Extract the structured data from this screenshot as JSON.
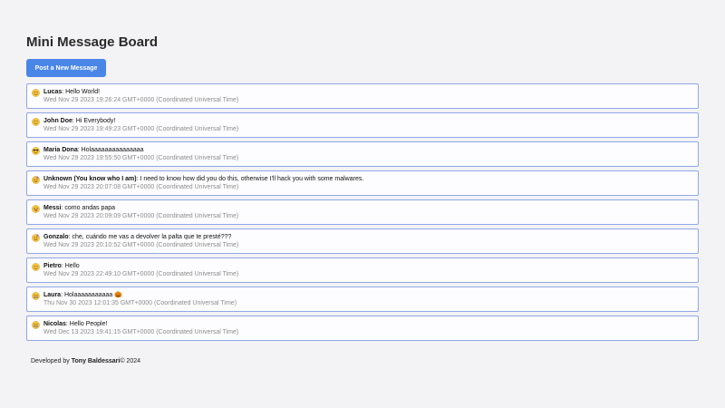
{
  "header": {
    "title": "Mini Message Board",
    "post_button_label": "Post a New Message"
  },
  "messages": [
    {
      "emoji": "winking-face-icon",
      "author": "Lucas",
      "text": "Hello World!",
      "date": "Wed Nov 29 2023 19:26:24 GMT+0000 (Coordinated Universal Time)"
    },
    {
      "emoji": "winking-face-icon",
      "author": "John Doe",
      "text": "Hi Everybody!",
      "date": "Wed Nov 29 2023 19:49:23 GMT+0000 (Coordinated Universal Time)"
    },
    {
      "emoji": "sunglasses-face-icon",
      "author": "Maria Dona",
      "text": "Holaaaaaaaaaaaaaaa",
      "date": "Wed Nov 29 2023 19:55:50 GMT+0000 (Coordinated Universal Time)"
    },
    {
      "emoji": "party-face-icon",
      "author": "Unknown (You know who I am)",
      "text": "I need to know how did you do this, otherwise I'll hack you with some malwares.",
      "date": "Wed Nov 29 2023 20:07:08 GMT+0000 (Coordinated Universal Time)"
    },
    {
      "emoji": "tongue-face-icon",
      "author": "Messi",
      "text": "como andas papa",
      "date": "Wed Nov 29 2023 20:09:09 GMT+0000 (Coordinated Universal Time)"
    },
    {
      "emoji": "party-face-icon",
      "author": "Gonzalo",
      "text": "che, cuándo me vas a devolver la palta que te presté???",
      "date": "Wed Nov 29 2023 20:10:52 GMT+0000 (Coordinated Universal Time)"
    },
    {
      "emoji": "winking-face-icon",
      "author": "Pietro",
      "text": "Hello",
      "date": "Wed Nov 29 2023 22:49:10 GMT+0000 (Coordinated Universal Time)"
    },
    {
      "emoji": "grimacing-face-icon",
      "author": "Laura",
      "text": "Holaaaaaaaaaaa 🎃",
      "date": "Thu Nov 30 2023 12:01:35 GMT+0000 (Coordinated Universal Time)"
    },
    {
      "emoji": "grimacing-face-icon",
      "author": "Nicolas",
      "text": "Hello People!",
      "date": "Wed Dec 13 2023 19:41:15 GMT+0000 (Coordinated Universal Time)"
    }
  ],
  "footer": {
    "prefix": "Developed by ",
    "developer": "Tony Baldessari",
    "suffix": "© 2024"
  },
  "colors": {
    "accent": "#4a86e8",
    "card_border": "#8fa8e6",
    "date_text": "#8c8c8c",
    "emoji_yellow": "#f5c33b"
  }
}
